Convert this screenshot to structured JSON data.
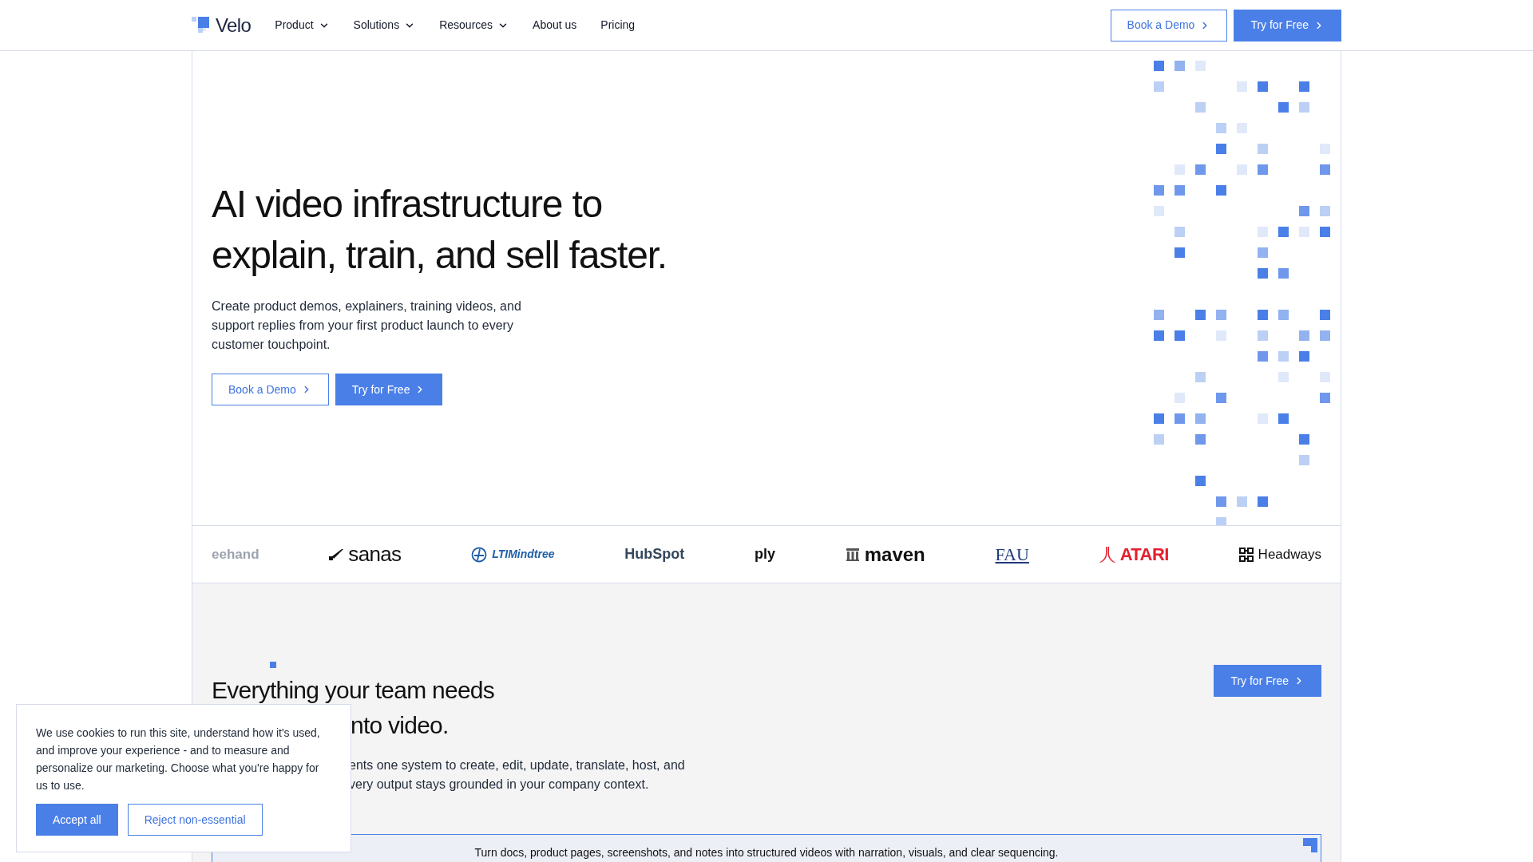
{
  "nav": {
    "logo": "Velo",
    "items": [
      {
        "label": "Product",
        "dropdown": true
      },
      {
        "label": "Solutions",
        "dropdown": true
      },
      {
        "label": "Resources",
        "dropdown": true
      },
      {
        "label": "About us",
        "dropdown": false
      },
      {
        "label": "Pricing",
        "dropdown": false
      }
    ],
    "buttons": [
      {
        "label": "Book a Demo",
        "kind": "outline"
      },
      {
        "label": "Try for Free",
        "kind": "solid"
      }
    ]
  },
  "hero": {
    "heading_lines": [
      "AI video infrastructure to",
      "explain, train, and sell faster."
    ],
    "text": "Create product demos, explainers, training videos, and support replies from your first product launch to every customer touchpoint.",
    "buttons": [
      {
        "label": "Book a Demo",
        "kind": "outline"
      },
      {
        "label": "Try for Free",
        "kind": "solid"
      }
    ]
  },
  "logos": [
    {
      "name": "eehand",
      "kind": "faded",
      "color": "#9ca3af"
    },
    {
      "name": "sanas",
      "kind": "mark",
      "color": "#111111"
    },
    {
      "name": "LTIMindtree",
      "kind": "globe",
      "color": "#1f5fa8"
    },
    {
      "name": "HubSpot",
      "kind": "plain",
      "color": "#33475b"
    },
    {
      "name": "ply",
      "kind": "plain",
      "color": "#111111"
    },
    {
      "name": "maven",
      "kind": "bars",
      "color": "#111111"
    },
    {
      "name": "FAU",
      "kind": "serif",
      "color": "#1f3a7a"
    },
    {
      "name": "ATARI",
      "kind": "atari",
      "color": "#e4202e"
    },
    {
      "name": "Headways",
      "kind": "grid",
      "color": "#111111"
    }
  ],
  "section": {
    "heading_lines": [
      "Everything your team needs",
      "nto video."
    ],
    "text_lines": [
      "ents one system to create, edit, update, translate, host, and",
      "very output stays grounded in your company context."
    ],
    "button": "Try for Free",
    "card_text": "Turn docs, product pages, screenshots, and notes into structured videos with narration, visuals, and clear sequencing."
  },
  "cookie": {
    "text": "We use cookies to run this site, understand how it's used, and improve your experience - and to measure and personalize our marketing. Choose what you're happy for us to use.",
    "buttons": [
      {
        "label": "Accept all",
        "kind": "solid"
      },
      {
        "label": "Reject non-essential",
        "kind": "outline"
      }
    ]
  }
}
